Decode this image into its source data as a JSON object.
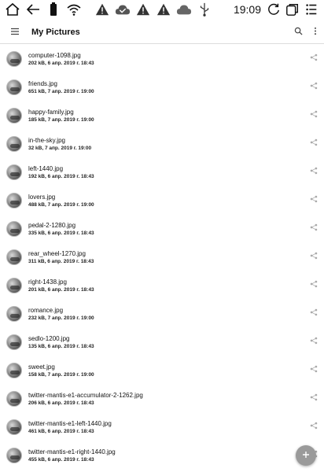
{
  "status_bar": {
    "time": "19:09",
    "icons": [
      "home-icon",
      "back-arrow-icon",
      "battery-icon",
      "wifi-icon",
      "warning-icon",
      "cloud-check-icon",
      "warning-icon",
      "warning-icon",
      "cloud-icon",
      "usb-icon",
      "refresh-icon",
      "window-icon",
      "menu-lines-icon"
    ]
  },
  "appbar": {
    "title": "My Pictures",
    "menu_icon": "hamburger-icon",
    "search_icon": "search-icon",
    "more_icon": "more-vertical-icon"
  },
  "files": [
    {
      "name": "computer-1098.jpg",
      "info": "202 kB, 6 апр. 2019 г. 18:43"
    },
    {
      "name": "friends.jpg",
      "info": "651 kB, 7 апр. 2019 г. 19:00"
    },
    {
      "name": "happy-family.jpg",
      "info": "185 kB, 7 апр. 2019 г. 19:00"
    },
    {
      "name": "in-the-sky.jpg",
      "info": "32 kB, 7 апр. 2019 г. 19:00"
    },
    {
      "name": "left-1440.jpg",
      "info": "192 kB, 6 апр. 2019 г. 18:43"
    },
    {
      "name": "lovers.jpg",
      "info": "488 kB, 7 апр. 2019 г. 19:00"
    },
    {
      "name": "pedal-2-1280.jpg",
      "info": "335 kB, 6 апр. 2019 г. 18:43"
    },
    {
      "name": "rear_wheel-1270.jpg",
      "info": "311 kB, 6 апр. 2019 г. 18:43"
    },
    {
      "name": "right-1438.jpg",
      "info": "201 kB, 6 апр. 2019 г. 18:43"
    },
    {
      "name": "romance.jpg",
      "info": "232 kB, 7 апр. 2019 г. 19:00"
    },
    {
      "name": "sedlo-1200.jpg",
      "info": "135 kB, 6 апр. 2019 г. 18:43"
    },
    {
      "name": "sweet.jpg",
      "info": "158 kB, 7 апр. 2019 г. 19:00"
    },
    {
      "name": "twitter-mantis-e1-accumulator-2-1262.jpg",
      "info": "206 kB, 6 апр. 2019 г. 18:43"
    },
    {
      "name": "twitter-mantis-e1-left-1440.jpg",
      "info": "461 kB, 6 апр. 2019 г. 18:43"
    },
    {
      "name": "twitter-mantis-e1-right-1440.jpg",
      "info": "455 kB, 6 апр. 2019 г. 18:43"
    }
  ],
  "share_icon": "share-icon",
  "fab": {
    "icon": "add-icon"
  }
}
